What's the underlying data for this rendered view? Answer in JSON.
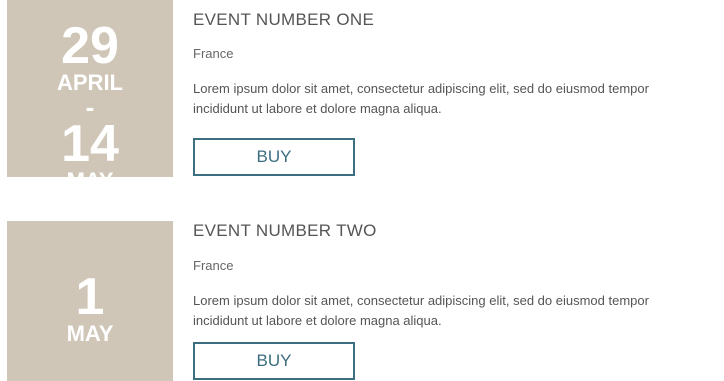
{
  "events": [
    {
      "day_start": "29",
      "month_start": "APRIL",
      "separator": "-",
      "day_end": "14",
      "month_end": "MAY",
      "title": "EVENT NUMBER ONE",
      "location": "France",
      "description_line1": "Lorem ipsum dolor sit amet, consectetur adipiscing elit, sed do eiusmod tempor",
      "description_line2": "incididunt ut labore et dolore magna aliqua.",
      "buy_label": "BUY"
    },
    {
      "day": "1",
      "month": "MAY",
      "title": "EVENT NUMBER TWO",
      "location": "France",
      "description_line1": "Lorem ipsum dolor sit amet, consectetur adipiscing elit, sed do eiusmod tempor",
      "description_line2": "incididunt ut labore et dolore magna aliqua.",
      "buy_label": "BUY"
    }
  ],
  "colors": {
    "date_box_bg": "#cfc6b8",
    "buy_accent": "#3c6e80"
  }
}
